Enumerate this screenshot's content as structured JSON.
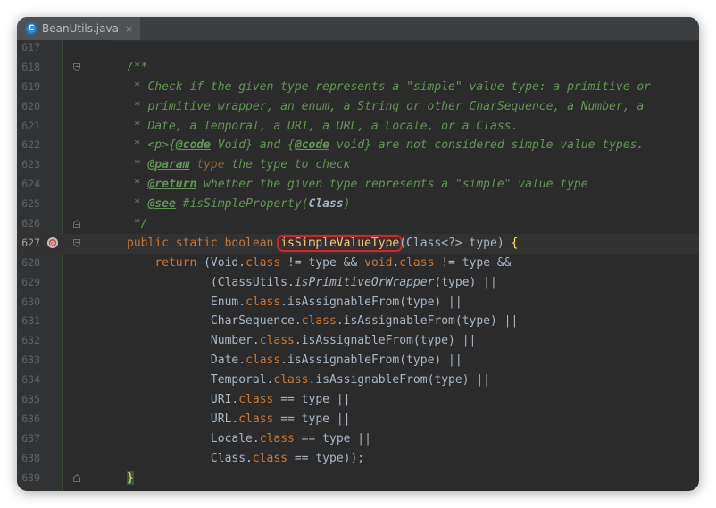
{
  "tab": {
    "icon_letter": "C",
    "title": "BeanUtils.java",
    "close": "×"
  },
  "lines": [
    {
      "num": "617",
      "segments": []
    },
    {
      "num": "618",
      "segments": [
        {
          "t": "/**",
          "c": "doc"
        }
      ]
    },
    {
      "num": "619",
      "segments": [
        {
          "t": " * Check if the given type represents a \"simple\" value type: a primitive or",
          "c": "doc"
        }
      ]
    },
    {
      "num": "620",
      "segments": [
        {
          "t": " * primitive wrapper, an enum, a String or other CharSequence, a Number, a",
          "c": "doc"
        }
      ]
    },
    {
      "num": "621",
      "segments": [
        {
          "t": " * Date, a Temporal, a URI, a URL, a Locale, or a Class.",
          "c": "doc"
        }
      ]
    },
    {
      "num": "622",
      "segments": [
        {
          "t": " * ",
          "c": "doc"
        },
        {
          "t": "<p>",
          "c": "doc"
        },
        {
          "t": "{",
          "c": "doc"
        },
        {
          "t": "@code",
          "c": "tagc"
        },
        {
          "t": " Void",
          "c": "doc"
        },
        {
          "t": "}",
          "c": "doc"
        },
        {
          "t": " and ",
          "c": "doc"
        },
        {
          "t": "{",
          "c": "doc"
        },
        {
          "t": "@code",
          "c": "tagc"
        },
        {
          "t": " void",
          "c": "doc"
        },
        {
          "t": "}",
          "c": "doc"
        },
        {
          "t": " are not considered simple value types.",
          "c": "doc"
        }
      ]
    },
    {
      "num": "623",
      "segments": [
        {
          "t": " * ",
          "c": "doc"
        },
        {
          "t": "@param",
          "c": "tagc"
        },
        {
          "t": " ",
          "c": "doc"
        },
        {
          "t": "type",
          "c": "paramc"
        },
        {
          "t": " the type to check",
          "c": "doc"
        }
      ]
    },
    {
      "num": "624",
      "segments": [
        {
          "t": " * ",
          "c": "doc"
        },
        {
          "t": "@return",
          "c": "tagc"
        },
        {
          "t": " whether the given type represents a \"simple\" value type",
          "c": "doc"
        }
      ]
    },
    {
      "num": "625",
      "segments": [
        {
          "t": " * ",
          "c": "doc"
        },
        {
          "t": "@see",
          "c": "tagc"
        },
        {
          "t": " #isSimpleProperty(",
          "c": "doc"
        },
        {
          "t": "Class",
          "c": "classref"
        },
        {
          "t": ")",
          "c": "doc"
        }
      ]
    },
    {
      "num": "626",
      "segments": [
        {
          "t": " */",
          "c": "doc"
        }
      ]
    },
    {
      "num": "627",
      "segments": [
        {
          "t": "public static boolean ",
          "c": "kw"
        },
        {
          "t": "isSimpleValueType",
          "c": "mname"
        },
        {
          "t": "(Class<?> type) ",
          "c": "plain"
        },
        {
          "t": "{",
          "c": "braceY"
        }
      ]
    },
    {
      "num": "628",
      "segments": [
        {
          "t": "    ",
          "c": "plain"
        },
        {
          "t": "return ",
          "c": "kw"
        },
        {
          "t": "(Void.",
          "c": "plain"
        },
        {
          "t": "class",
          "c": "kw"
        },
        {
          "t": " != type && ",
          "c": "plain"
        },
        {
          "t": "void",
          "c": "kw"
        },
        {
          "t": ".",
          "c": "plain"
        },
        {
          "t": "class",
          "c": "kw"
        },
        {
          "t": " != type &&",
          "c": "plain"
        }
      ]
    },
    {
      "num": "629",
      "segments": [
        {
          "t": "            (ClassUtils.",
          "c": "plain"
        },
        {
          "t": "isPrimitiveOrWrapper",
          "c": "ital"
        },
        {
          "t": "(type) ||",
          "c": "plain"
        }
      ]
    },
    {
      "num": "630",
      "segments": [
        {
          "t": "            Enum.",
          "c": "plain"
        },
        {
          "t": "class",
          "c": "kw"
        },
        {
          "t": ".isAssignableFrom(type) ||",
          "c": "plain"
        }
      ]
    },
    {
      "num": "631",
      "segments": [
        {
          "t": "            CharSequence.",
          "c": "plain"
        },
        {
          "t": "class",
          "c": "kw"
        },
        {
          "t": ".isAssignableFrom(type) ||",
          "c": "plain"
        }
      ]
    },
    {
      "num": "632",
      "segments": [
        {
          "t": "            Number.",
          "c": "plain"
        },
        {
          "t": "class",
          "c": "kw"
        },
        {
          "t": ".isAssignableFrom(type) ||",
          "c": "plain"
        }
      ]
    },
    {
      "num": "633",
      "segments": [
        {
          "t": "            Date.",
          "c": "plain"
        },
        {
          "t": "class",
          "c": "kw"
        },
        {
          "t": ".isAssignableFrom(type) ||",
          "c": "plain"
        }
      ]
    },
    {
      "num": "634",
      "segments": [
        {
          "t": "            Temporal.",
          "c": "plain"
        },
        {
          "t": "class",
          "c": "kw"
        },
        {
          "t": ".isAssignableFrom(type) ||",
          "c": "plain"
        }
      ]
    },
    {
      "num": "635",
      "segments": [
        {
          "t": "            URI.",
          "c": "plain"
        },
        {
          "t": "class",
          "c": "kw"
        },
        {
          "t": " == type ||",
          "c": "plain"
        }
      ]
    },
    {
      "num": "636",
      "segments": [
        {
          "t": "            URL.",
          "c": "plain"
        },
        {
          "t": "class",
          "c": "kw"
        },
        {
          "t": " == type ||",
          "c": "plain"
        }
      ]
    },
    {
      "num": "637",
      "segments": [
        {
          "t": "            Locale.",
          "c": "plain"
        },
        {
          "t": "class",
          "c": "kw"
        },
        {
          "t": " == type ||",
          "c": "plain"
        }
      ]
    },
    {
      "num": "638",
      "segments": [
        {
          "t": "            Class.",
          "c": "plain"
        },
        {
          "t": "class",
          "c": "kw"
        },
        {
          "t": " == type));",
          "c": "plain"
        }
      ]
    },
    {
      "num": "639",
      "segments": [
        {
          "t": "}",
          "c": "closebrace"
        }
      ]
    }
  ],
  "current_line": "627",
  "fold_markers": {
    "618": "open",
    "626": "close",
    "627": "open",
    "639": "close"
  },
  "colors": {
    "background": "#2b2b2b",
    "doc_comment": "#629755",
    "keyword": "#cc7832",
    "method": "#ffc66d",
    "highlight_box": "#e02020"
  }
}
